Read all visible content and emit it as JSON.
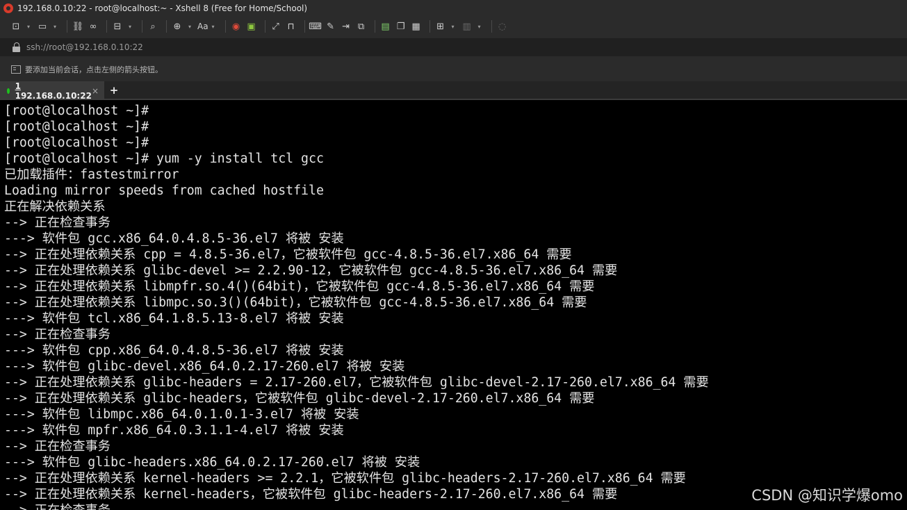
{
  "window": {
    "title": "192.168.0.10:22 - root@localhost:~ - Xshell 8 (Free for Home/School)"
  },
  "toolbar": {
    "icons": [
      "new-session-icon",
      "dropdown",
      "open-folder-icon",
      "dropdown",
      "reconnect-icon",
      "disconnect-icon",
      "new-window-icon",
      "dropdown",
      "search-icon",
      "globe-icon",
      "dropdown",
      "font-icon",
      "dropdown",
      "xshell-icon",
      "xftp-icon",
      "fullscreen-icon",
      "lock-icon",
      "keyboard-icon",
      "compose-icon",
      "transfer-icon",
      "script-icon",
      "log-icon",
      "copy-icon",
      "paste-icon",
      "add-tab-icon",
      "dropdown",
      "layout-icon",
      "dropdown",
      "help-icon"
    ],
    "font_label": "Aa"
  },
  "address": {
    "text": "ssh://root@192.168.0.10:22"
  },
  "hint": {
    "text": "要添加当前会话，点击左侧的箭头按钮。"
  },
  "tabs": [
    {
      "number": "1",
      "label": "192.168.0.10:22",
      "close": "×",
      "active": true
    }
  ],
  "tab_add_label": "+",
  "colors": {
    "status_dot": "#1ec11e",
    "terminal_bg": "#000000",
    "terminal_fg": "#e3e3e3"
  },
  "terminal": {
    "lines": [
      "[root@localhost ~]#",
      "[root@localhost ~]#",
      "[root@localhost ~]#",
      "[root@localhost ~]# yum -y install tcl gcc",
      "已加载插件：fastestmirror",
      "Loading mirror speeds from cached hostfile",
      "正在解决依赖关系",
      "--> 正在检查事务",
      "---> 软件包 gcc.x86_64.0.4.8.5-36.el7 将被 安装",
      "--> 正在处理依赖关系 cpp = 4.8.5-36.el7，它被软件包 gcc-4.8.5-36.el7.x86_64 需要",
      "--> 正在处理依赖关系 glibc-devel >= 2.2.90-12，它被软件包 gcc-4.8.5-36.el7.x86_64 需要",
      "--> 正在处理依赖关系 libmpfr.so.4()(64bit)，它被软件包 gcc-4.8.5-36.el7.x86_64 需要",
      "--> 正在处理依赖关系 libmpc.so.3()(64bit)，它被软件包 gcc-4.8.5-36.el7.x86_64 需要",
      "---> 软件包 tcl.x86_64.1.8.5.13-8.el7 将被 安装",
      "--> 正在检查事务",
      "---> 软件包 cpp.x86_64.0.4.8.5-36.el7 将被 安装",
      "---> 软件包 glibc-devel.x86_64.0.2.17-260.el7 将被 安装",
      "--> 正在处理依赖关系 glibc-headers = 2.17-260.el7，它被软件包 glibc-devel-2.17-260.el7.x86_64 需要",
      "--> 正在处理依赖关系 glibc-headers，它被软件包 glibc-devel-2.17-260.el7.x86_64 需要",
      "---> 软件包 libmpc.x86_64.0.1.0.1-3.el7 将被 安装",
      "---> 软件包 mpfr.x86_64.0.3.1.1-4.el7 将被 安装",
      "--> 正在检查事务",
      "---> 软件包 glibc-headers.x86_64.0.2.17-260.el7 将被 安装",
      "--> 正在处理依赖关系 kernel-headers >= 2.2.1，它被软件包 glibc-headers-2.17-260.el7.x86_64 需要",
      "--> 正在处理依赖关系 kernel-headers，它被软件包 glibc-headers-2.17-260.el7.x86_64 需要",
      "--> 正在检查事务"
    ]
  },
  "watermark": "CSDN @知识学爆omo"
}
